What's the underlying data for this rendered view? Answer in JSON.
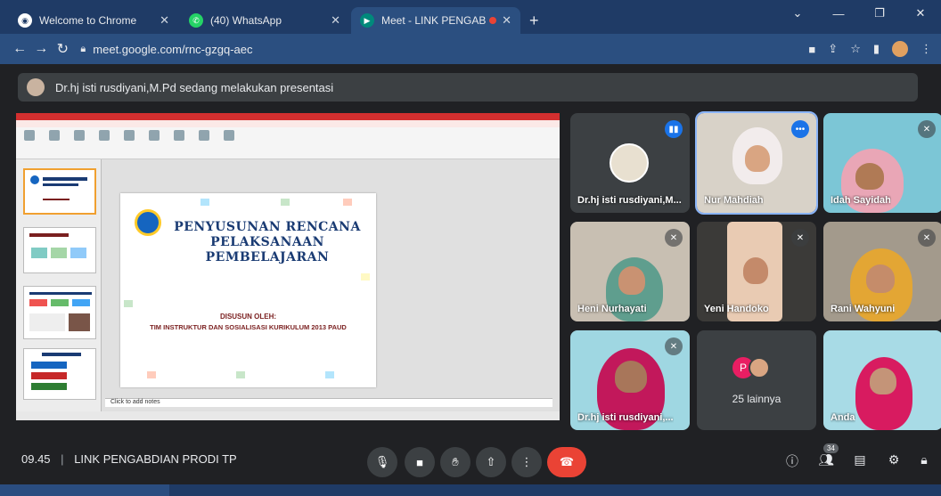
{
  "browser": {
    "tabs": [
      {
        "title": "Welcome to Chrome",
        "icon": "chrome-icon"
      },
      {
        "title": "(40) WhatsApp",
        "icon": "whatsapp-icon"
      },
      {
        "title": "Meet - LINK PENGABDIAN P",
        "icon": "meet-icon"
      }
    ],
    "url": "meet.google.com/rnc-gzgq-aec"
  },
  "meet": {
    "presenting_banner": "Dr.hj isti rusdiyani,M.Pd sedang melakukan presentasi",
    "slide": {
      "title_line1": "PENYUSUNAN RENCANA",
      "title_line2": "PELAKSANAAN",
      "title_line3": "PEMBELAJARAN",
      "by_label": "DISUSUN OLEH:",
      "by_team": "TIM INSTRUKTUR DAN SOSIALISASI KURIKULUM 2013 PAUD",
      "notes_placeholder": "Click to add notes"
    },
    "participants": [
      {
        "name": "Dr.hj isti rusdiyani,M..."
      },
      {
        "name": "Nur Mahdiah"
      },
      {
        "name": "Idah Sayidah"
      },
      {
        "name": "Heni Nurhayati"
      },
      {
        "name": "Yeni Handoko"
      },
      {
        "name": "Rani Wahyuni"
      },
      {
        "name": "Dr.hj isti rusdiyani,..."
      },
      {
        "name": "25 lainnya",
        "avatar_letter": "P"
      },
      {
        "name": "Anda"
      }
    ],
    "time": "09.45",
    "meeting_name": "LINK PENGABDIAN PRODI TP",
    "people_count": "34"
  },
  "colors": {
    "tab_bar": "#1f3b66",
    "end_call": "#ea4335",
    "meet_bg": "#202124"
  }
}
